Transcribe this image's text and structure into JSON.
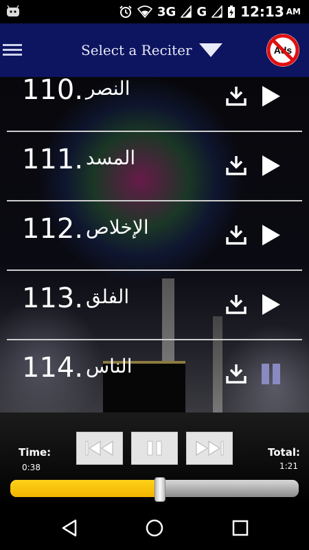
{
  "status_bar": {
    "network": "3G",
    "network2": "G",
    "time": "12:13",
    "ampm": "AM"
  },
  "header": {
    "title": "Select a Reciter",
    "ads_label": "Ads"
  },
  "surahs": [
    {
      "number": "110.",
      "name": "النصر",
      "state": "play"
    },
    {
      "number": "111.",
      "name": "المسد",
      "state": "play"
    },
    {
      "number": "112.",
      "name": "الإخلاص",
      "state": "play"
    },
    {
      "number": "113.",
      "name": "الفلق",
      "state": "play"
    },
    {
      "number": "114.",
      "name": "الناس",
      "state": "playing"
    }
  ],
  "player": {
    "time_label": "Time:",
    "time_value": "0:38",
    "total_label": "Total:",
    "total_value": "1:21",
    "progress_fraction": 0.52
  },
  "colors": {
    "appbar": "#0d1460",
    "progress": "#ffcc00",
    "pause_icon": "#8a8ac2"
  }
}
